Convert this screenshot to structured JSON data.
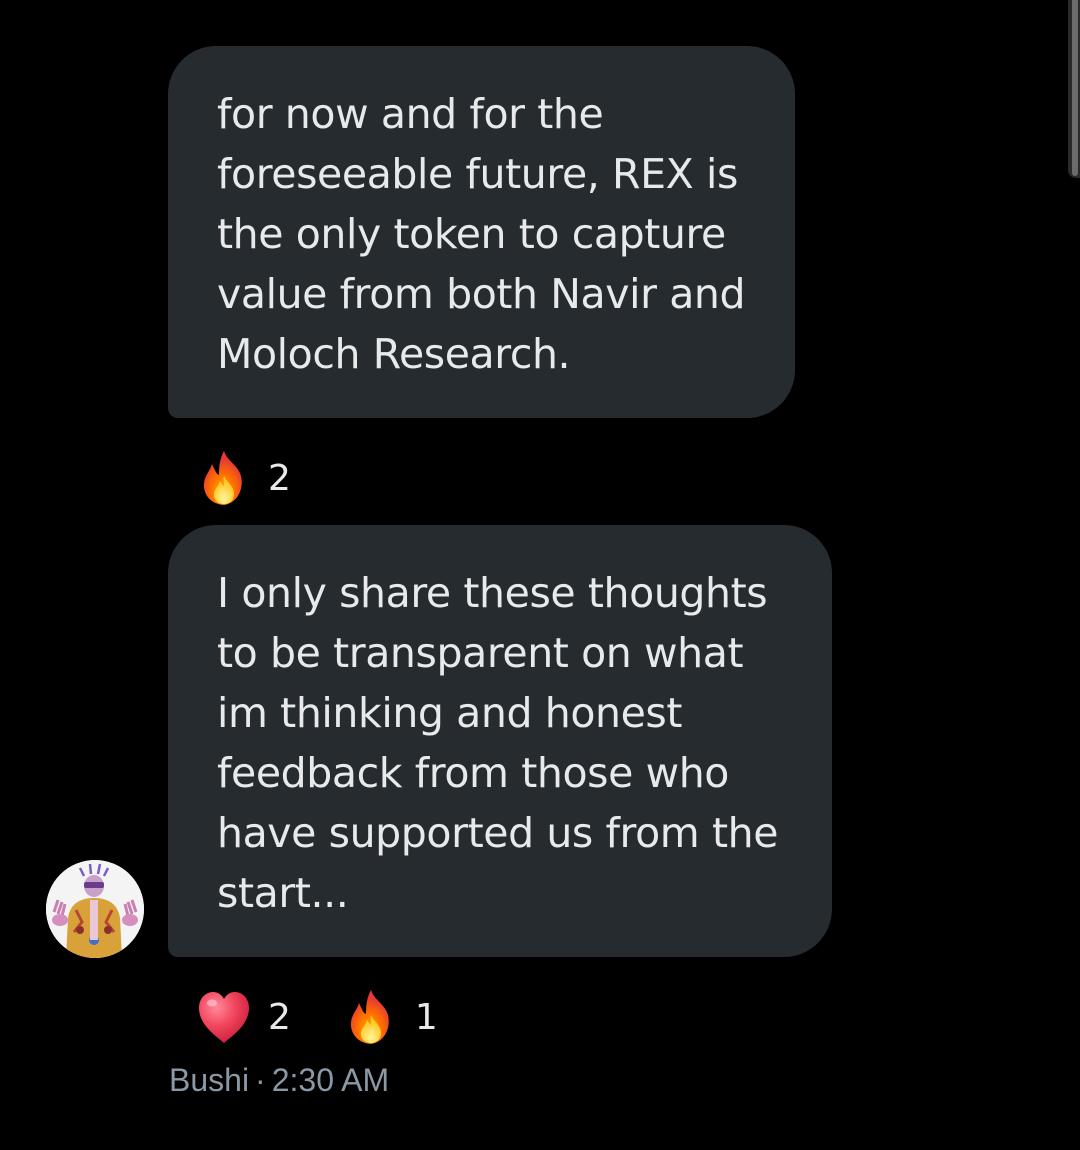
{
  "messages": [
    {
      "lines": [
        "for now and for the",
        "foreseeable future, REX is",
        "the only token to capture",
        "value from both Navir and",
        "Moloch Research."
      ],
      "reactions": [
        {
          "icon": "fire-icon",
          "count": "2"
        }
      ]
    },
    {
      "lines": [
        "I only share these thoughts",
        "to be transparent on what",
        "im thinking and honest",
        "feedback from those who",
        "have supported us from the",
        "start..."
      ],
      "reactions": [
        {
          "icon": "heart-icon",
          "count": "2"
        },
        {
          "icon": "fire-icon",
          "count": "1"
        }
      ]
    }
  ],
  "sender": {
    "name": "Bushi",
    "separator": "·",
    "time": "2:30 AM"
  },
  "colors": {
    "background": "#000000",
    "bubble": "#262b30",
    "text": "#e7e9ea",
    "meta": "#8b98a5"
  }
}
